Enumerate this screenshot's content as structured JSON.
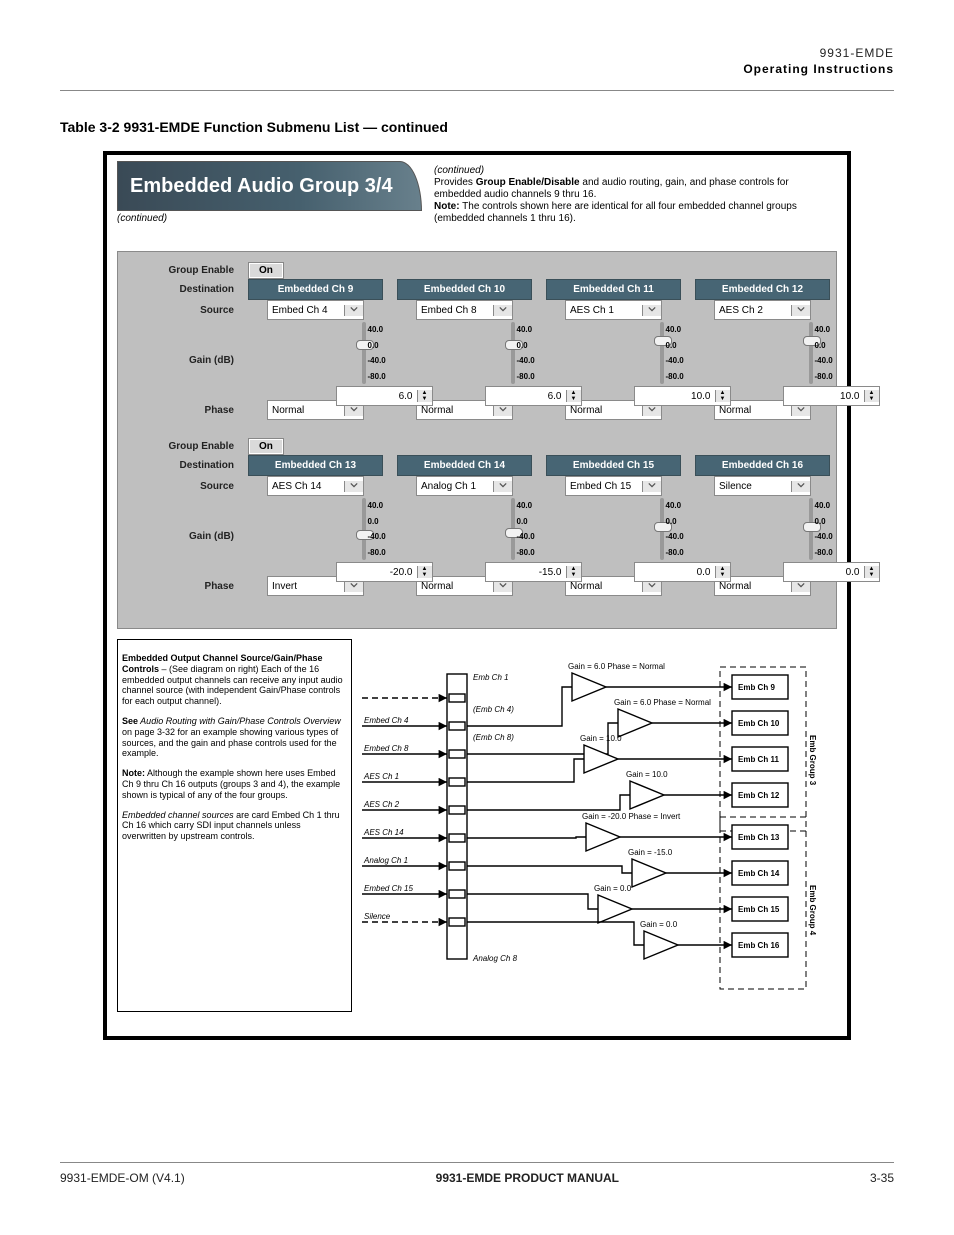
{
  "header": {
    "doc_model": "9931-EMDE",
    "doc_title": "Operating Instructions"
  },
  "footer": {
    "rev": "9931-EMDE-OM (V4.1)",
    "title": "9931-EMDE PRODUCT MANUAL",
    "page": "3-35"
  },
  "section_title": "Table 3-2  9931-EMDE Function Submenu List — continued",
  "tab": {
    "label": "Embedded Audio Group 3/4",
    "right_top": "(continued)",
    "right_line1_a": "Provides ",
    "right_line1_b": "Group Enable/Disable",
    "right_line1_c": " and audio routing, gain, and phase controls for embedded audio channels 9 thru 16.",
    "right_note_a": "Note:",
    "right_note_b": " The controls shown here are identical for all four embedded channel groups (embedded channels 1 thru 16)."
  },
  "continued_label": "(continued)",
  "labels": {
    "group_enable": "Group Enable",
    "destination": "Destination",
    "source": "Source",
    "gain": "Gain (dB)",
    "phase": "Phase",
    "on": "On"
  },
  "ticks": [
    "40.0",
    "0.0",
    "-40.0",
    "-80.0"
  ],
  "group3": {
    "channels": [
      {
        "dest": "Embedded Ch 9",
        "source": "Embed Ch 4",
        "gain": "6.0",
        "knob": 20,
        "phase": "Normal"
      },
      {
        "dest": "Embedded Ch 10",
        "source": "Embed Ch 8",
        "gain": "6.0",
        "knob": 20,
        "phase": "Normal"
      },
      {
        "dest": "Embedded Ch 11",
        "source": "AES Ch 1",
        "gain": "10.0",
        "knob": 16,
        "phase": "Normal"
      },
      {
        "dest": "Embedded Ch 12",
        "source": "AES Ch 2",
        "gain": "10.0",
        "knob": 16,
        "phase": "Normal"
      }
    ]
  },
  "group4": {
    "channels": [
      {
        "dest": "Embedded Ch 13",
        "source": "AES Ch 14",
        "gain": "-20.0",
        "knob": 34,
        "phase": "Invert"
      },
      {
        "dest": "Embedded Ch 14",
        "source": "Analog Ch 1",
        "gain": "-15.0",
        "knob": 32,
        "phase": "Normal"
      },
      {
        "dest": "Embedded Ch 15",
        "source": "Embed Ch 15",
        "gain": "0.0",
        "knob": 26,
        "phase": "Normal"
      },
      {
        "dest": "Embedded Ch 16",
        "source": "Silence",
        "gain": "0.0",
        "knob": 26,
        "phase": "Normal"
      }
    ]
  },
  "legend": {
    "p1_b": "Embedded Output Channel Source/Gain/Phase Controls",
    "p1_t": " – (See diagram on right) Each of the 16 embedded output channels can receive any input audio channel source (with independent Gain/Phase controls for each output channel).",
    "p2_b": "See",
    "p2_i": " Audio Routing with Gain/Phase Controls Overview ",
    "p2_t": "on page 3-32 for an example showing various types of sources, and the gain and phase controls used for the example.",
    "p3_b": "Note:",
    "p3_t": " Although the example shown here uses Embed Ch 9 thru Ch 16 outputs (groups 3 and 4), the example shown is typical of any of the four groups.",
    "p4_i": "Embedded channel sources",
    "p4_t": " are card Embed Ch 1 thru Ch 16 which carry SDI input channels unless overwritten by upstream controls."
  },
  "diagram": {
    "inputs": [
      "",
      "Embed Ch 4",
      "Embed Ch 8",
      "AES Ch 1",
      "AES Ch 2",
      "AES Ch 14",
      "Analog Ch 1",
      "Embed Ch 15",
      "Silence"
    ],
    "mux_top": "Emb Ch 1",
    "mux_hint1": "(Emb Ch 4)",
    "mux_hint2": "(Emb Ch 8)",
    "mux_bot": "Analog Ch 8",
    "amps": [
      "Gain = 6.0  Phase = Normal",
      "Gain = 6.0  Phase = Normal",
      "Gain = 10.0  ",
      "Gain = 10.0  ",
      "Gain = -20.0  Phase = Invert",
      "Gain = -15.0  ",
      "Gain = 0.0  ",
      "Gain = 0.0  "
    ],
    "outs": [
      "Emb Ch 9",
      "Emb Ch 10",
      "Emb Ch 11",
      "Emb Ch 12",
      "Emb Ch 13",
      "Emb Ch 14",
      "Emb Ch 15",
      "Emb Ch 16"
    ],
    "grp3": "Emb Group 3",
    "grp4": "Emb Group 4"
  },
  "icons": {
    "chevron": "chevron-down-icon"
  }
}
